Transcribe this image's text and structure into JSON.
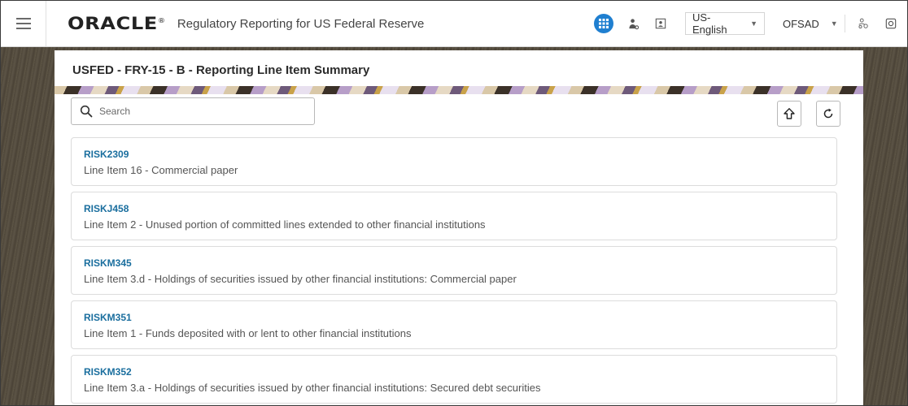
{
  "header": {
    "brand": "ORACLE",
    "brand_mark": "®",
    "app_title": "Regulatory Reporting for US Federal Reserve",
    "language": "US-English",
    "user": "OFSAD"
  },
  "page": {
    "title": "USFED - FRY-15 - B - Reporting Line Item Summary"
  },
  "search": {
    "placeholder": "Search",
    "value": ""
  },
  "items": [
    {
      "code": "RISK2309",
      "description": "Line Item 16 - Commercial paper"
    },
    {
      "code": "RISKJ458",
      "description": "Line Item 2 - Unused portion of committed lines extended to other financial institutions"
    },
    {
      "code": "RISKM345",
      "description": "Line Item 3.d - Holdings of securities issued by other financial institutions: Commercial paper"
    },
    {
      "code": "RISKM351",
      "description": "Line Item 1 - Funds deposited with or lent to other financial institutions"
    },
    {
      "code": "RISKM352",
      "description": "Line Item 3.a - Holdings of securities issued by other financial institutions: Secured debt securities"
    }
  ],
  "colors": {
    "accent": "#1f7fd0",
    "link": "#1a6e9e",
    "backdrop": "#5a5347"
  },
  "icons": {
    "menu": "hamburger-menu-icon",
    "apps": "app-grid-icon",
    "user": "user-icon",
    "profile": "profile-card-icon",
    "hierarchy": "hierarchy-icon",
    "settings": "settings-icon",
    "search": "search-icon",
    "export": "arrow-up-icon",
    "refresh": "refresh-icon"
  }
}
